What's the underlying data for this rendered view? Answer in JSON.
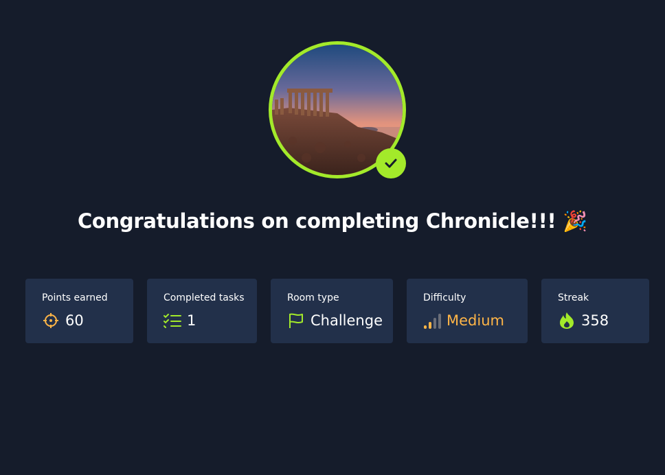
{
  "headline": {
    "text": "Congratulations on completing Chronicle!!! 🎉"
  },
  "avatar": {
    "icon": "temple-photo",
    "badge_icon": "check-icon"
  },
  "stats": [
    {
      "label": "Points earned",
      "value": "60",
      "icon": "crosshair-icon",
      "icon_color": "#ffb547"
    },
    {
      "label": "Completed tasks",
      "value": "1",
      "icon": "task-list-icon",
      "icon_color": "#a3ea2a"
    },
    {
      "label": "Room type",
      "value": "Challenge",
      "icon": "flag-icon",
      "icon_color": "#a3ea2a"
    },
    {
      "label": "Difficulty",
      "value": "Medium",
      "icon": "signal-bars-icon",
      "icon_color": "#ffb547"
    },
    {
      "label": "Streak",
      "value": "358",
      "icon": "flame-icon",
      "icon_color": "#a3ea2a"
    }
  ],
  "colors": {
    "background": "#151c2b",
    "card": "#22304a",
    "accent_green": "#a3ea2a",
    "accent_orange": "#ffb547"
  }
}
